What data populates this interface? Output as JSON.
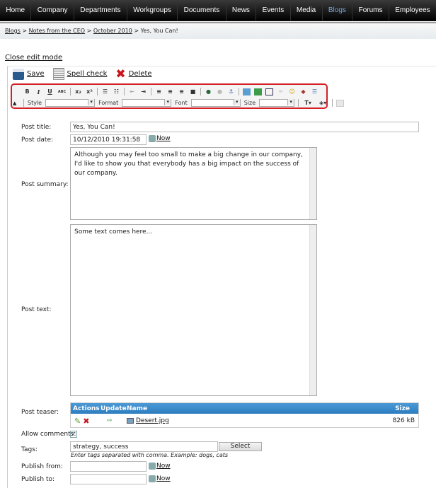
{
  "nav": {
    "items": [
      "Home",
      "Company",
      "Departments",
      "Workgroups",
      "Documents",
      "News",
      "Events",
      "Media",
      "Blogs",
      "Forums",
      "Employees"
    ],
    "active": "Blogs"
  },
  "breadcrumb": {
    "items": [
      "Blogs",
      "Notes from the CEO",
      "October 2010"
    ],
    "current": "Yes, You Can!",
    "separator": ">"
  },
  "close_edit": "Close edit mode",
  "toolbar": {
    "save": "Save",
    "spell": "Spell check",
    "delete": "Delete"
  },
  "editor": {
    "style": "Style",
    "format": "Format",
    "font": "Font",
    "size": "Size",
    "bold": "B",
    "italic": "I",
    "underline": "U",
    "strike": "ABC",
    "sub": "x₂",
    "sup": "x²"
  },
  "form": {
    "title_label": "Post title:",
    "title": "Yes, You Can!",
    "date_label": "Post date:",
    "date": "10/12/2010 19:31:58",
    "now": "Now",
    "summary_label": "Post summary:",
    "summary": "Although you may feel too small to make a big change in our company, I'd like to show you that everybody has a big impact on the success of our company.",
    "text_label": "Post text:",
    "text": "Some text comes here...",
    "teaser_label": "Post teaser:",
    "teaser": {
      "columns": [
        "Actions",
        "Update",
        "Name",
        "Size"
      ],
      "file": "Desert.jpg",
      "size": "826 kB"
    },
    "comments_label": "Allow comments:",
    "comments_checked": true,
    "tags_label": "Tags:",
    "tags": "strategy, success",
    "select": "Select",
    "tags_hint": "Enter tags separated with comma. Example: dogs, cats",
    "from_label": "Publish from:",
    "to_label": "Publish to:"
  },
  "colors": {
    "highlight": "#d41f25",
    "grid_header": "#3a8ccc"
  }
}
